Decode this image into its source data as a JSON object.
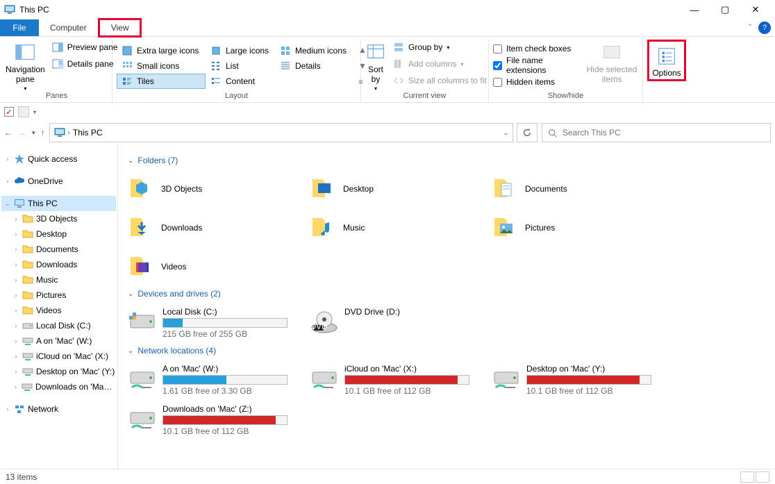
{
  "window": {
    "title": "This PC"
  },
  "tabs": {
    "file": "File",
    "computer": "Computer",
    "view": "View"
  },
  "ribbon": {
    "panes": {
      "nav": "Navigation pane",
      "preview": "Preview pane",
      "details": "Details pane",
      "label": "Panes"
    },
    "layout": {
      "xl": "Extra large icons",
      "large": "Large icons",
      "medium": "Medium icons",
      "small": "Small icons",
      "list": "List",
      "details": "Details",
      "tiles": "Tiles",
      "content": "Content",
      "label": "Layout"
    },
    "currentview": {
      "sort": "Sort by",
      "group": "Group by",
      "addcols": "Add columns",
      "sizecols": "Size all columns to fit",
      "label": "Current view"
    },
    "showhide": {
      "itemcheck": "Item check boxes",
      "ext": "File name extensions",
      "hidden": "Hidden items",
      "hidesel": "Hide selected items",
      "label": "Show/hide"
    },
    "options": "Options"
  },
  "address": {
    "root": "This PC"
  },
  "search": {
    "placeholder": "Search This PC"
  },
  "tree": {
    "quick": "Quick access",
    "onedrive": "OneDrive",
    "thispc": "This PC",
    "items": [
      "3D Objects",
      "Desktop",
      "Documents",
      "Downloads",
      "Music",
      "Pictures",
      "Videos",
      "Local Disk (C:)",
      "A on 'Mac' (W:)",
      "iCloud on 'Mac' (X:)",
      "Desktop on 'Mac' (Y:)",
      "Downloads on 'Mac' (Z:)"
    ],
    "network": "Network"
  },
  "sections": {
    "folders": {
      "title": "Folders (7)",
      "items": [
        "3D Objects",
        "Desktop",
        "Documents",
        "Downloads",
        "Music",
        "Pictures",
        "Videos"
      ]
    },
    "drives": {
      "title": "Devices and drives (2)",
      "items": [
        {
          "name": "Local Disk (C:)",
          "sub": "215 GB free of 255 GB",
          "fill": 16,
          "color": "blue",
          "type": "hdd"
        },
        {
          "name": "DVD Drive (D:)",
          "sub": "",
          "fill": 0,
          "color": "none",
          "type": "dvd"
        }
      ]
    },
    "network": {
      "title": "Network locations (4)",
      "items": [
        {
          "name": "A on 'Mac' (W:)",
          "sub": "1.61 GB free of 3.30 GB",
          "fill": 51,
          "color": "blue"
        },
        {
          "name": "iCloud on 'Mac' (X:)",
          "sub": "10.1 GB free of 112 GB",
          "fill": 91,
          "color": "red"
        },
        {
          "name": "Desktop on 'Mac' (Y:)",
          "sub": "10.1 GB free of 112 GB",
          "fill": 91,
          "color": "red"
        },
        {
          "name": "Downloads on 'Mac' (Z:)",
          "sub": "10.1 GB free of 112 GB",
          "fill": 91,
          "color": "red"
        }
      ]
    }
  },
  "status": {
    "items": "13 items"
  }
}
